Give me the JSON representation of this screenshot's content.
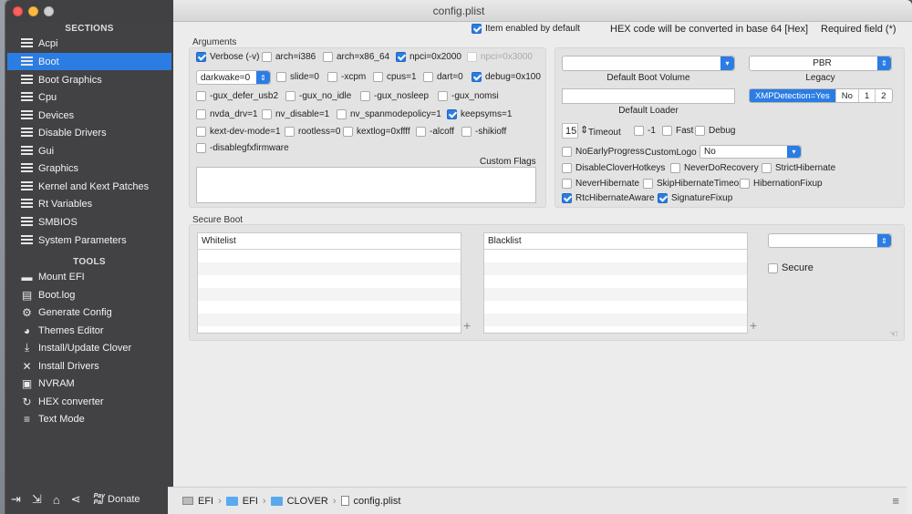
{
  "window": {
    "title": "config.plist"
  },
  "top_bar": {
    "item_enabled_default": "Item enabled by default",
    "hex_note": "HEX code will be converted in base 64 [Hex]",
    "required_field": "Required field (*)"
  },
  "sidebar": {
    "sections_header": "SECTIONS",
    "sections": [
      {
        "label": "Acpi"
      },
      {
        "label": "Boot"
      },
      {
        "label": "Boot Graphics"
      },
      {
        "label": "Cpu"
      },
      {
        "label": "Devices"
      },
      {
        "label": "Disable Drivers"
      },
      {
        "label": "Gui"
      },
      {
        "label": "Graphics"
      },
      {
        "label": "Kernel and Kext Patches"
      },
      {
        "label": "Rt Variables"
      },
      {
        "label": "SMBIOS"
      },
      {
        "label": "System Parameters"
      }
    ],
    "tools_header": "TOOLS",
    "tools": [
      {
        "label": "Mount EFI",
        "icon": "drive-icon"
      },
      {
        "label": "Boot.log",
        "icon": "log-icon"
      },
      {
        "label": "Generate Config",
        "icon": "gears-icon"
      },
      {
        "label": "Themes Editor",
        "icon": "palette-icon"
      },
      {
        "label": "Install/Update Clover",
        "icon": "download-icon"
      },
      {
        "label": "Install Drivers",
        "icon": "wrench-icon"
      },
      {
        "label": "NVRAM",
        "icon": "chip-icon"
      },
      {
        "label": "HEX converter",
        "icon": "refresh-icon"
      },
      {
        "label": "Text Mode",
        "icon": "text-icon"
      }
    ],
    "donate": "Donate",
    "paypal_top": "Pay",
    "paypal_bottom": "Pal"
  },
  "arguments": {
    "title": "Arguments",
    "row1": [
      {
        "label": "Verbose (-v)",
        "checked": true
      },
      {
        "label": "arch=i386",
        "checked": false
      },
      {
        "label": "arch=x86_64",
        "checked": false
      },
      {
        "label": "npci=0x2000",
        "checked": true
      },
      {
        "label": "npci=0x3000",
        "checked": false
      }
    ],
    "darkwake_value": "darkwake=0",
    "row2": [
      {
        "label": "slide=0"
      },
      {
        "label": "-xcpm"
      },
      {
        "label": "cpus=1"
      },
      {
        "label": "dart=0"
      },
      {
        "label": "debug=0x100"
      }
    ],
    "row3": [
      {
        "label": "-gux_defer_usb2"
      },
      {
        "label": "-gux_no_idle"
      },
      {
        "label": "-gux_nosleep"
      },
      {
        "label": "-gux_nomsi"
      }
    ],
    "row4": [
      {
        "label": "nvda_drv=1"
      },
      {
        "label": "nv_disable=1"
      },
      {
        "label": "nv_spanmodepolicy=1"
      },
      {
        "label": "keepsyms=1"
      }
    ],
    "row5": [
      {
        "label": "kext-dev-mode=1"
      },
      {
        "label": "rootless=0"
      },
      {
        "label": "kextlog=0xffff"
      },
      {
        "label": "-alcoff"
      },
      {
        "label": "-shikioff"
      }
    ],
    "row6": [
      {
        "label": "-disablegfxfirmware"
      }
    ],
    "custom_flags": "Custom Flags"
  },
  "right_panel": {
    "default_boot_volume": "Default Boot Volume",
    "pbr_value": "PBR",
    "legacy": "Legacy",
    "default_loader": "Default Loader",
    "xmp_segments": [
      "XMPDetection=Yes",
      "No",
      "1",
      "2"
    ],
    "timeout_value": "15",
    "timeout_label": "Timeout",
    "timeout_opts": [
      {
        "label": "-1"
      },
      {
        "label": "Fast"
      },
      {
        "label": "Debug"
      }
    ],
    "no_early_progress": "NoEarlyProgress",
    "custom_logo_label": "CustomLogo",
    "custom_logo_value": "No",
    "flags_row1": [
      {
        "label": "DisableCloverHotkeys"
      },
      {
        "label": "NeverDoRecovery"
      },
      {
        "label": "StrictHibernate"
      }
    ],
    "flags_row2": [
      {
        "label": "NeverHibernate"
      },
      {
        "label": "SkipHibernateTimeout"
      },
      {
        "label": "HibernationFixup"
      }
    ],
    "flags_row3": [
      {
        "label": "RtcHibernateAware"
      },
      {
        "label": "SignatureFixup"
      }
    ]
  },
  "secure_boot": {
    "title": "Secure Boot",
    "whitelist": "Whitelist",
    "blacklist": "Blacklist",
    "secure": "Secure"
  },
  "pathbar": [
    "EFI",
    "EFI",
    "CLOVER",
    "config.plist"
  ]
}
